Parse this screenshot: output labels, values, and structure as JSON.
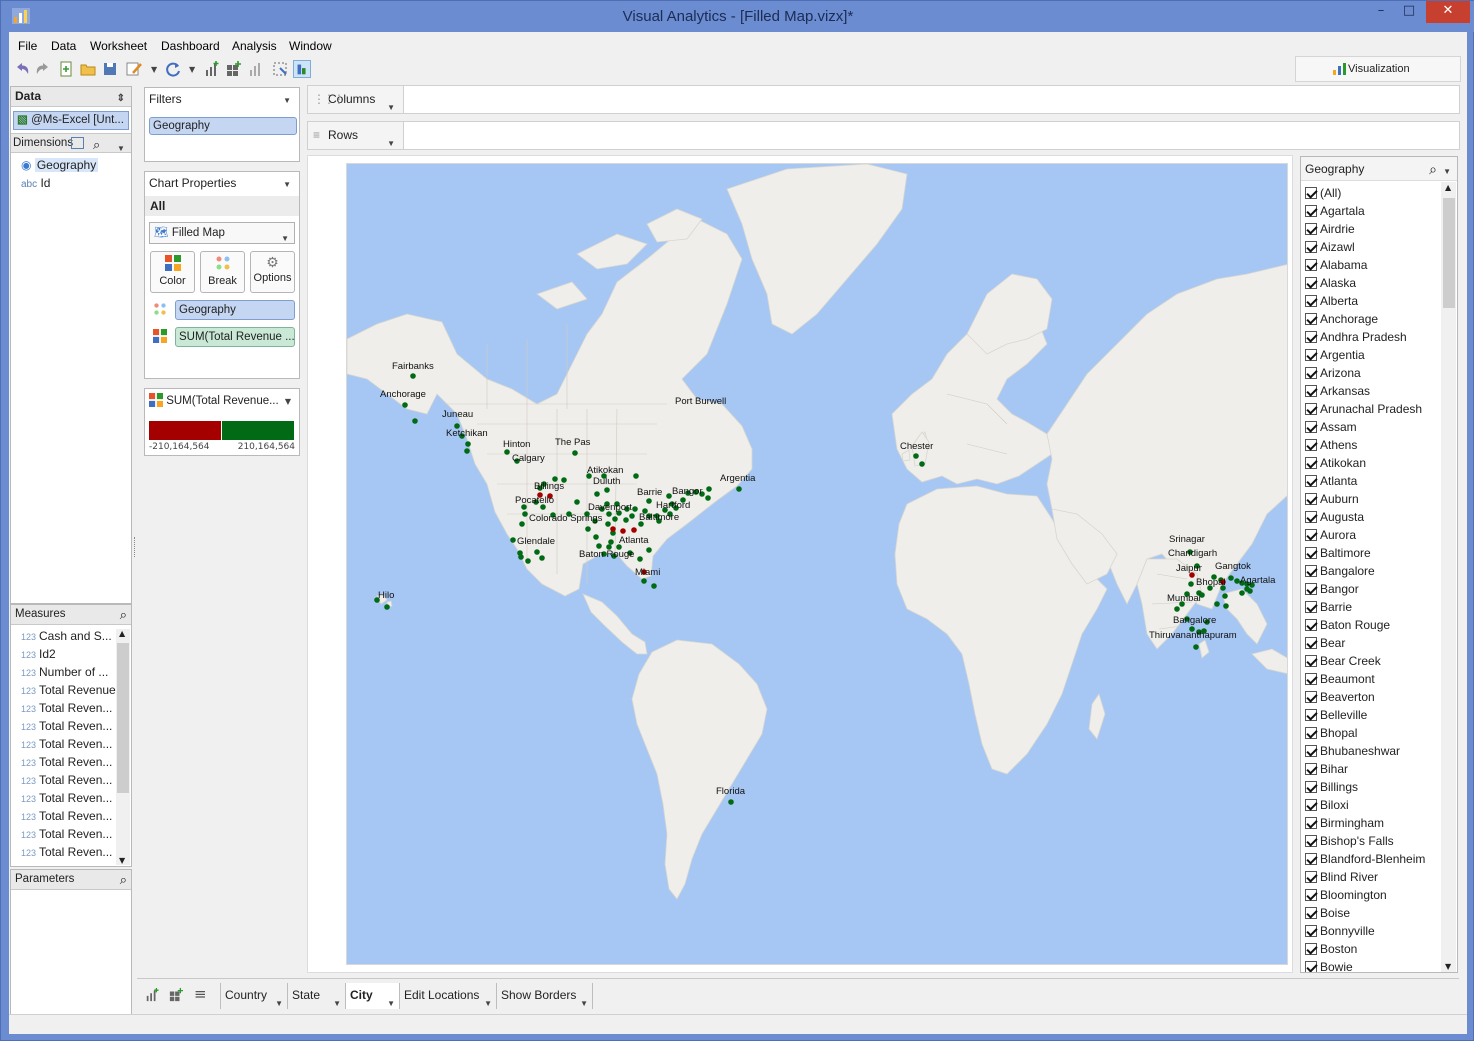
{
  "window": {
    "title": "Visual Analytics - [Filled Map.vizx]*",
    "controls": [
      "–",
      "□",
      "✕"
    ]
  },
  "menu": [
    "File",
    "Data",
    "Worksheet",
    "Dashboard",
    "Analysis",
    "Window"
  ],
  "toolbar": {
    "visualization_label": "Visualization"
  },
  "data_panel": {
    "title": "Data",
    "source": "@Ms-Excel [Unt...",
    "dimensions_label": "Dimensions",
    "dimensions": [
      "Geography",
      "Id"
    ],
    "measures_label": "Measures",
    "measures": [
      "Cash and S...",
      "Id2",
      "Number of ...",
      "Total Revenue",
      "Total Reven...",
      "Total Reven...",
      "Total Reven...",
      "Total Reven...",
      "Total Reven...",
      "Total Reven...",
      "Total Reven...",
      "Total Reven...",
      "Total Reven..."
    ],
    "parameters_label": "Parameters"
  },
  "filters": {
    "title": "Filters",
    "pill": "Geography"
  },
  "chart_properties": {
    "title": "Chart Properties",
    "scope": "All",
    "chart_type": "Filled Map",
    "buttons": [
      "Color",
      "Break",
      "Options"
    ],
    "break_pill": "Geography",
    "color_pill": "SUM(Total Revenue ..."
  },
  "legend": {
    "title": "SUM(Total Revenue...",
    "min_label": "-210,164,564",
    "max_label": "210,164,564",
    "neg_color": "#a50000",
    "pos_color": "#006a15"
  },
  "shelves": {
    "columns": "Columns",
    "rows": "Rows"
  },
  "map": {
    "labels": [
      "Fairbanks",
      "Anchorage",
      "Juneau",
      "Ketchikan",
      "Hinton",
      "Calgary",
      "The Pas",
      "Atikokan",
      "Duluth",
      "Billings",
      "Pocatello",
      "Colorado Springs",
      "Davenport",
      "Barrie",
      "Bangor",
      "Hartford",
      "Baltimore",
      "Atlanta",
      "Glendale",
      "Baton Rouge",
      "Miami",
      "Port Burwell",
      "Argentia",
      "Chester",
      "Hilo",
      "Florida",
      "Srinagar",
      "Chandigarh",
      "Jaipur",
      "Gangtok",
      "Bhopal",
      "Agartala",
      "Mumbai",
      "Bangalore",
      "Thiruvananthapuram"
    ]
  },
  "geo_filter": {
    "title": "Geography",
    "items": [
      "(All)",
      "Agartala",
      "Airdrie",
      "Aizawl",
      "Alabama",
      "Alaska",
      "Alberta",
      "Anchorage",
      "Andhra Pradesh",
      "Argentia",
      "Arizona",
      "Arkansas",
      "Arunachal Pradesh",
      "Assam",
      "Athens",
      "Atikokan",
      "Atlanta",
      "Auburn",
      "Augusta",
      "Aurora",
      "Baltimore",
      "Bangalore",
      "Bangor",
      "Barrie",
      "Baton Rouge",
      "Bear",
      "Bear Creek",
      "Beaumont",
      "Beaverton",
      "Belleville",
      "Bhopal",
      "Bhubaneshwar",
      "Bihar",
      "Billings",
      "Biloxi",
      "Birmingham",
      "Bishop's Falls",
      "Blandford-Blenheim",
      "Blind River",
      "Bloomington",
      "Boise",
      "Bonnyville",
      "Boston",
      "Bowie"
    ]
  },
  "tabs": [
    "Country",
    "State",
    "City",
    "Edit Locations",
    "Show Borders"
  ],
  "active_tab": "City"
}
